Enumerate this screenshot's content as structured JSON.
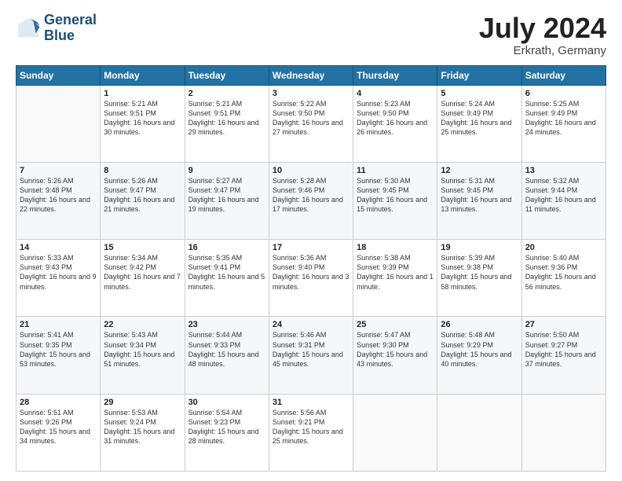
{
  "logo": {
    "line1": "General",
    "line2": "Blue"
  },
  "title": {
    "month_year": "July 2024",
    "location": "Erkrath, Germany"
  },
  "weekdays": [
    "Sunday",
    "Monday",
    "Tuesday",
    "Wednesday",
    "Thursday",
    "Friday",
    "Saturday"
  ],
  "weeks": [
    [
      {
        "day": "",
        "sunrise": "",
        "sunset": "",
        "daylight": ""
      },
      {
        "day": "1",
        "sunrise": "5:21 AM",
        "sunset": "9:51 PM",
        "daylight": "16 hours and 30 minutes."
      },
      {
        "day": "2",
        "sunrise": "5:21 AM",
        "sunset": "9:51 PM",
        "daylight": "16 hours and 29 minutes."
      },
      {
        "day": "3",
        "sunrise": "5:22 AM",
        "sunset": "9:50 PM",
        "daylight": "16 hours and 27 minutes."
      },
      {
        "day": "4",
        "sunrise": "5:23 AM",
        "sunset": "9:50 PM",
        "daylight": "16 hours and 26 minutes."
      },
      {
        "day": "5",
        "sunrise": "5:24 AM",
        "sunset": "9:49 PM",
        "daylight": "16 hours and 25 minutes."
      },
      {
        "day": "6",
        "sunrise": "5:25 AM",
        "sunset": "9:49 PM",
        "daylight": "16 hours and 24 minutes."
      }
    ],
    [
      {
        "day": "7",
        "sunrise": "5:26 AM",
        "sunset": "9:48 PM",
        "daylight": "16 hours and 22 minutes."
      },
      {
        "day": "8",
        "sunrise": "5:26 AM",
        "sunset": "9:47 PM",
        "daylight": "16 hours and 21 minutes."
      },
      {
        "day": "9",
        "sunrise": "5:27 AM",
        "sunset": "9:47 PM",
        "daylight": "16 hours and 19 minutes."
      },
      {
        "day": "10",
        "sunrise": "5:28 AM",
        "sunset": "9:46 PM",
        "daylight": "16 hours and 17 minutes."
      },
      {
        "day": "11",
        "sunrise": "5:30 AM",
        "sunset": "9:45 PM",
        "daylight": "16 hours and 15 minutes."
      },
      {
        "day": "12",
        "sunrise": "5:31 AM",
        "sunset": "9:45 PM",
        "daylight": "16 hours and 13 minutes."
      },
      {
        "day": "13",
        "sunrise": "5:32 AM",
        "sunset": "9:44 PM",
        "daylight": "16 hours and 11 minutes."
      }
    ],
    [
      {
        "day": "14",
        "sunrise": "5:33 AM",
        "sunset": "9:43 PM",
        "daylight": "16 hours and 9 minutes."
      },
      {
        "day": "15",
        "sunrise": "5:34 AM",
        "sunset": "9:42 PM",
        "daylight": "16 hours and 7 minutes."
      },
      {
        "day": "16",
        "sunrise": "5:35 AM",
        "sunset": "9:41 PM",
        "daylight": "16 hours and 5 minutes."
      },
      {
        "day": "17",
        "sunrise": "5:36 AM",
        "sunset": "9:40 PM",
        "daylight": "16 hours and 3 minutes."
      },
      {
        "day": "18",
        "sunrise": "5:38 AM",
        "sunset": "9:39 PM",
        "daylight": "16 hours and 1 minute."
      },
      {
        "day": "19",
        "sunrise": "5:39 AM",
        "sunset": "9:38 PM",
        "daylight": "15 hours and 58 minutes."
      },
      {
        "day": "20",
        "sunrise": "5:40 AM",
        "sunset": "9:36 PM",
        "daylight": "15 hours and 56 minutes."
      }
    ],
    [
      {
        "day": "21",
        "sunrise": "5:41 AM",
        "sunset": "9:35 PM",
        "daylight": "15 hours and 53 minutes."
      },
      {
        "day": "22",
        "sunrise": "5:43 AM",
        "sunset": "9:34 PM",
        "daylight": "15 hours and 51 minutes."
      },
      {
        "day": "23",
        "sunrise": "5:44 AM",
        "sunset": "9:33 PM",
        "daylight": "15 hours and 48 minutes."
      },
      {
        "day": "24",
        "sunrise": "5:46 AM",
        "sunset": "9:31 PM",
        "daylight": "15 hours and 45 minutes."
      },
      {
        "day": "25",
        "sunrise": "5:47 AM",
        "sunset": "9:30 PM",
        "daylight": "15 hours and 43 minutes."
      },
      {
        "day": "26",
        "sunrise": "5:48 AM",
        "sunset": "9:29 PM",
        "daylight": "15 hours and 40 minutes."
      },
      {
        "day": "27",
        "sunrise": "5:50 AM",
        "sunset": "9:27 PM",
        "daylight": "15 hours and 37 minutes."
      }
    ],
    [
      {
        "day": "28",
        "sunrise": "5:51 AM",
        "sunset": "9:26 PM",
        "daylight": "15 hours and 34 minutes."
      },
      {
        "day": "29",
        "sunrise": "5:53 AM",
        "sunset": "9:24 PM",
        "daylight": "15 hours and 31 minutes."
      },
      {
        "day": "30",
        "sunrise": "5:54 AM",
        "sunset": "9:23 PM",
        "daylight": "15 hours and 28 minutes."
      },
      {
        "day": "31",
        "sunrise": "5:56 AM",
        "sunset": "9:21 PM",
        "daylight": "15 hours and 25 minutes."
      },
      {
        "day": "",
        "sunrise": "",
        "sunset": "",
        "daylight": ""
      },
      {
        "day": "",
        "sunrise": "",
        "sunset": "",
        "daylight": ""
      },
      {
        "day": "",
        "sunrise": "",
        "sunset": "",
        "daylight": ""
      }
    ]
  ]
}
